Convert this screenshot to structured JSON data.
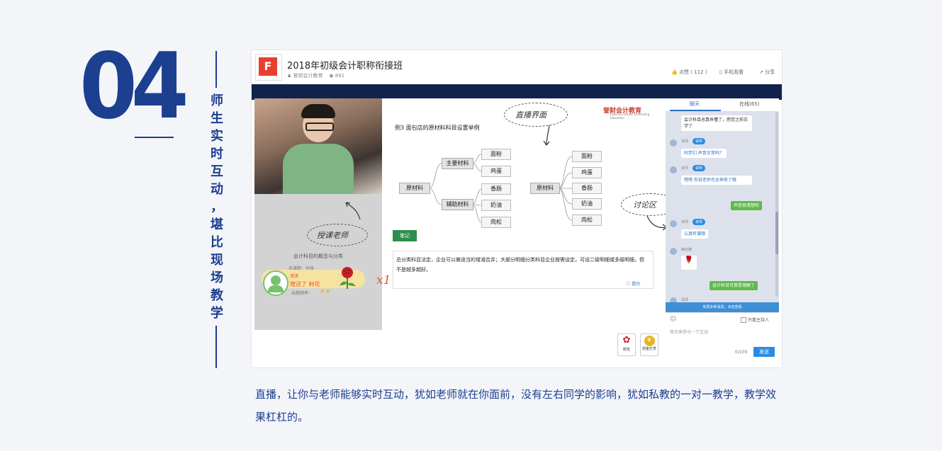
{
  "number": "04",
  "vertical_title": [
    "师",
    "生",
    "实",
    "时",
    "互",
    "动",
    "，",
    "堪",
    "比",
    "现",
    "场",
    "教",
    "学"
  ],
  "caption": "直播，让你与老师能够实时互动，犹如老师就在你面前，没有左右同学的影响，犹如私教的一对一教学，教学效果杠杠的。",
  "colors": {
    "brand_blue": "#1c3f8f",
    "accent_red": "#e2553d",
    "chat_blue": "#2a8be1",
    "chat_green": "#5fba4a"
  },
  "screenshot": {
    "course_title": "2018年初级会计职称衔接班",
    "author": "誉财会计教育",
    "views": "891",
    "likes_label": "点赞 ( 112 )",
    "mobile_label": "手机观看",
    "share_label": "分享",
    "annotations": {
      "live": "直播界面",
      "teacher": "授课老师",
      "discuss": "讨论区"
    },
    "teacher_panel": {
      "lesson_title": "会计科目的概念与分类",
      "subtitle": "总课题：总账",
      "rate_label": "出题频率：",
      "stars": "★★",
      "gift_sender": "潇潇",
      "gift_text": "赠送了 鲜花",
      "gift_count": "x1"
    },
    "board": {
      "brand": "誉财会计教育",
      "brand_sub": "Fame & Fortune Accounting Education",
      "example_title": "例3 面包店的原材料科目设置举例",
      "left_tree": {
        "root": "原材料",
        "branches": [
          {
            "label": "主要材料",
            "leaves": [
              "面粉",
              "鸡蛋"
            ]
          },
          {
            "label": "辅助材料",
            "leaves": [
              "香肠",
              "奶油",
              "肉松"
            ]
          }
        ]
      },
      "right_tree": {
        "root": "原材料",
        "leaves": [
          "面粉",
          "鸡蛋",
          "香肠",
          "奶油",
          "肉松"
        ]
      },
      "note_tag": "笔记",
      "note_text": "总分类科目法定，企业可以做适当的增减合并；大部分明细分类科目企业按需设定，可设二级明细或多级明细，但不是越多越好。",
      "ask_label": "提问",
      "tools": [
        {
          "icon": "flower-icon",
          "label": "鲜花"
        },
        {
          "icon": "coin-icon",
          "label": "现金打赏"
        }
      ]
    },
    "chat": {
      "tabs": [
        "聊天",
        "在线(65)"
      ],
      "messages": [
        {
          "type": "user",
          "text": "会计科目总算弄懂了，感觉之前白学了"
        },
        {
          "type": "teacher",
          "name": "讲师",
          "badge": "讲师",
          "text": "同学们 声音正常吗？"
        },
        {
          "type": "teacher",
          "name": "讲师",
          "badge": "讲师",
          "text": "嗒嗒 你说老师也太神奇了哦"
        },
        {
          "type": "self",
          "text": "声音很清楚哈"
        },
        {
          "type": "teacher",
          "name": "讲师",
          "badge": "讲师",
          "text": "认真听课哦"
        },
        {
          "type": "user",
          "name": "梅花糖",
          "text": "🌹"
        },
        {
          "type": "self",
          "text": "会计科目可算是理解了"
        },
        {
          "type": "user",
          "name": "潇潇",
          "text": ""
        }
      ],
      "new_messages": "有更多新消息，点击查看",
      "host_only_label": "只看主持人",
      "placeholder": "我也来参与一下互动",
      "counter": "0/100",
      "send_label": "发送"
    }
  }
}
